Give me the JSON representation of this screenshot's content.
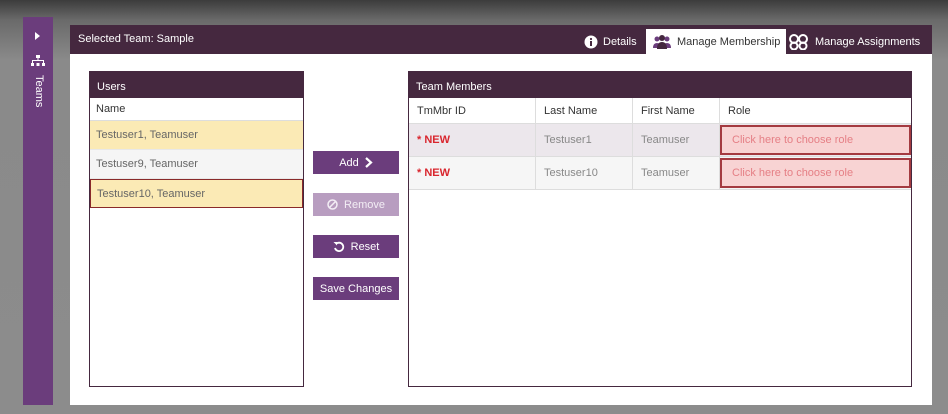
{
  "sidebar": {
    "label": "Teams"
  },
  "header": {
    "selected_team": "Selected Team: Sample",
    "tabs": [
      {
        "label": "Details",
        "icon": "info-icon"
      },
      {
        "label": "Manage Membership",
        "icon": "team-icon",
        "active": true
      },
      {
        "label": "Manage Assignments",
        "icon": "assignments-icon"
      }
    ]
  },
  "users": {
    "title": "Users",
    "column": "Name",
    "rows": [
      "Testuser1, Teamuser",
      "Testuser9, Teamuser",
      "Testuser10, Teamuser"
    ]
  },
  "actions": {
    "add": "Add",
    "remove": "Remove",
    "reset": "Reset",
    "save": "Save Changes"
  },
  "team_members": {
    "title": "Team Members",
    "columns": [
      "TmMbr ID",
      "Last Name",
      "First Name",
      "Role"
    ],
    "rows": [
      {
        "id": "* NEW",
        "last": "Testuser1",
        "first": "Teamuser",
        "role": "Click here to choose role"
      },
      {
        "id": "* NEW",
        "last": "Testuser10",
        "first": "Teamuser",
        "role": "Click here to choose role"
      }
    ]
  },
  "colors": {
    "accent": "#6b3d7c",
    "header": "#45283f",
    "highlight": "#fbeab5",
    "new_text": "#d9262e",
    "role_bg": "#f8d3d3"
  }
}
